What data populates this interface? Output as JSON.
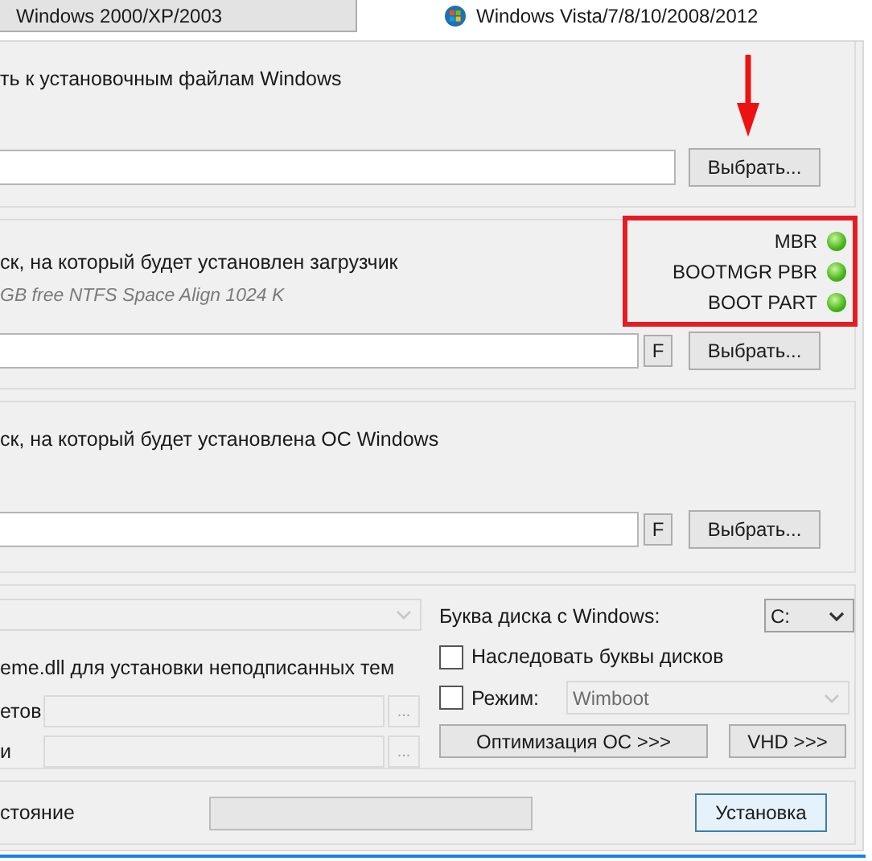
{
  "tabs": [
    {
      "label": "Windows 2000/XP/2003",
      "selected": false
    },
    {
      "label": "Windows Vista/7/8/10/2008/2012",
      "selected": true
    }
  ],
  "source": {
    "label": "ть к установочным файлам Windows",
    "button": "Выбрать..."
  },
  "boot": {
    "label": "ск, на который будет установлен загрузчик",
    "info": "GB free NTFS Space Align 1024 K",
    "f_button": "F",
    "button": "Выбрать...",
    "status": [
      {
        "name": "MBR",
        "ok": true
      },
      {
        "name": "BOOTMGR PBR",
        "ok": true
      },
      {
        "name": "BOOT PART",
        "ok": true
      }
    ]
  },
  "install": {
    "label": "ск, на который будет установлена ОС Windows",
    "f_button": "F",
    "button": "Выбрать..."
  },
  "options": {
    "combo_1": {
      "disabled": true
    },
    "drive_letter": {
      "label": "Буква диска с Windows:",
      "value": "C:"
    },
    "uxtheme": {
      "label": "eme.dll для установки неподписанных тем"
    },
    "inherit": {
      "label": "Наследовать буквы дисков",
      "checked": false
    },
    "field_rows": [
      {
        "label": "етов",
        "disabled": true,
        "button": "..."
      },
      {
        "label": "и",
        "disabled": true,
        "button": "..."
      }
    ],
    "mode": {
      "label": "Режим:",
      "checked": false,
      "value": "Wimboot",
      "disabled": true
    },
    "buttons": [
      "Оптимизация ОС >>>",
      "VHD >>>"
    ]
  },
  "status_bar": {
    "label": "стояние",
    "level": 0,
    "button": "Установка"
  }
}
